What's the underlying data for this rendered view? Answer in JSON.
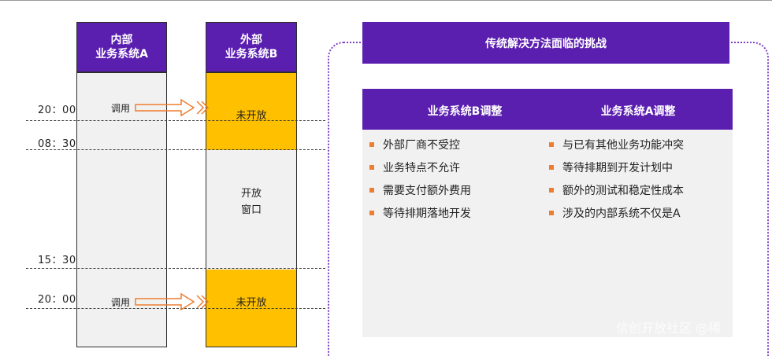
{
  "left": {
    "colA_title_line1": "内部",
    "colA_title_line2": "业务系统A",
    "colB_title_line1": "外部",
    "colB_title_line2": "业务系统B",
    "call_label_1": "调用",
    "call_label_2": "调用",
    "closed_label_1": "未开放",
    "closed_label_2": "未开放",
    "open_label_line1": "开放",
    "open_label_line2": "窗口",
    "times": [
      "20：00",
      "08：30",
      "15：30",
      "20：00"
    ]
  },
  "right": {
    "title": "传统解决方法面临的挑战",
    "b_header": "业务系统B调整",
    "a_header": "业务系统A调整",
    "b_items": [
      "外部厂商不受控",
      "业务特点不允许",
      "需要支付额外费用",
      "等待排期落地开发"
    ],
    "a_items": [
      "与已有其他业务功能冲突",
      "等待排期到开发计划中",
      "额外的测试和稳定性成本",
      "涉及的内部系统不仅是A"
    ]
  },
  "watermark": "信创开放社区 @稀",
  "colors": {
    "purple": "#5b1fb0",
    "yellow": "#ffc000",
    "bullet": "#ed7d31",
    "panel_gray": "#f1f1f1"
  }
}
